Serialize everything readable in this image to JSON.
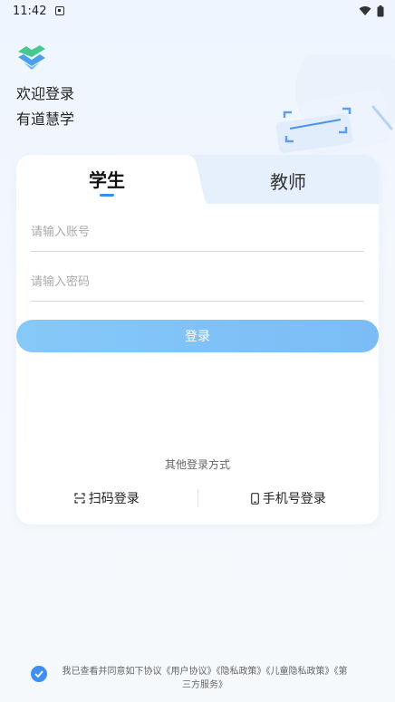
{
  "status": {
    "time": "11:42"
  },
  "welcome": {
    "line1": "欢迎登录",
    "line2": "有道慧学"
  },
  "tabs": {
    "student": "学生",
    "teacher": "教师"
  },
  "form": {
    "account_placeholder": "请输入账号",
    "password_placeholder": "请输入密码",
    "login_label": "登录"
  },
  "other_login": {
    "title": "其他登录方式",
    "scan": "扫码登录",
    "phone": "手机号登录"
  },
  "agreement": {
    "prefix": "我已查看并同意如下协议",
    "links": [
      "《用户协议》",
      "《隐私政策》",
      "《儿童隐私政策》",
      "《第三方服务》"
    ]
  },
  "colors": {
    "accent": "#3b8cf0",
    "button": "#7bbcf6",
    "tab_inactive_bg": "#e6f0fd"
  }
}
